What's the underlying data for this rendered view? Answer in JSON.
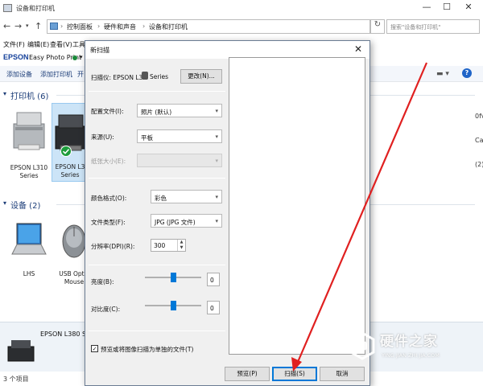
{
  "window": {
    "title": "设备和打印机",
    "min": "—",
    "max": "☐",
    "close": "✕"
  },
  "address": {
    "crumbs": [
      "控制面板",
      "硬件和声音",
      "设备和打印机"
    ],
    "search_placeholder": "搜索\"设备和打印机\""
  },
  "menu": {
    "file": "文件(F)",
    "edit": "编辑(E)",
    "view": "查看(V)",
    "tools": "工具"
  },
  "epson": {
    "logo": "EPSON",
    "app": "Easy Photo Print"
  },
  "commands": {
    "add_device": "添加设备",
    "add_printer": "添加打印机",
    "cut": "开"
  },
  "printers": {
    "header": "打印机 (6)",
    "items": [
      {
        "label": "EPSON L310 Series"
      },
      {
        "label": "EPSON L3 Series"
      }
    ]
  },
  "devices": {
    "header": "设备 (2)",
    "items": [
      {
        "label": "LHS"
      },
      {
        "label": "USB Optic Mouse"
      }
    ]
  },
  "right_cut": {
    "a": "0fv",
    "b": "Ca",
    "c": "(2)"
  },
  "details": {
    "name": "EPSON L380 Series"
  },
  "status": {
    "text": "3 个项目"
  },
  "dialog": {
    "title": "新扫描",
    "scanner_label": "扫描仪: EPSON L3",
    "scanner_label_tail": "Series",
    "change_button": "更改(N)...",
    "profile_label": "配置文件(I):",
    "profile_value": "照片 (默认)",
    "source_label": "来源(U):",
    "source_value": "平板",
    "paper_label": "纸张大小(E):",
    "paper_value": "",
    "color_label": "颜色格式(O):",
    "color_value": "彩色",
    "filetype_label": "文件类型(F):",
    "filetype_value": "JPG (JPG 文件)",
    "dpi_label": "分辨率(DPI)(R):",
    "dpi_value": "300",
    "brightness_label": "亮度(B):",
    "brightness_value": "0",
    "brightness_level": 0.5,
    "contrast_label": "对比度(C):",
    "contrast_value": "0",
    "contrast_level": 0.5,
    "separate_files_label": "预览或将图像扫描为单独的文件(T)",
    "preview_button": "预览(P)",
    "scan_button": "扫描(S)",
    "cancel_button": "取消"
  },
  "watermark": {
    "text": "硬件之家",
    "sub": "YING JIAN ZHI JIA.COM"
  },
  "colors": {
    "accent": "#0078d7",
    "arrow": "#e02020",
    "link": "#1c3d78"
  }
}
